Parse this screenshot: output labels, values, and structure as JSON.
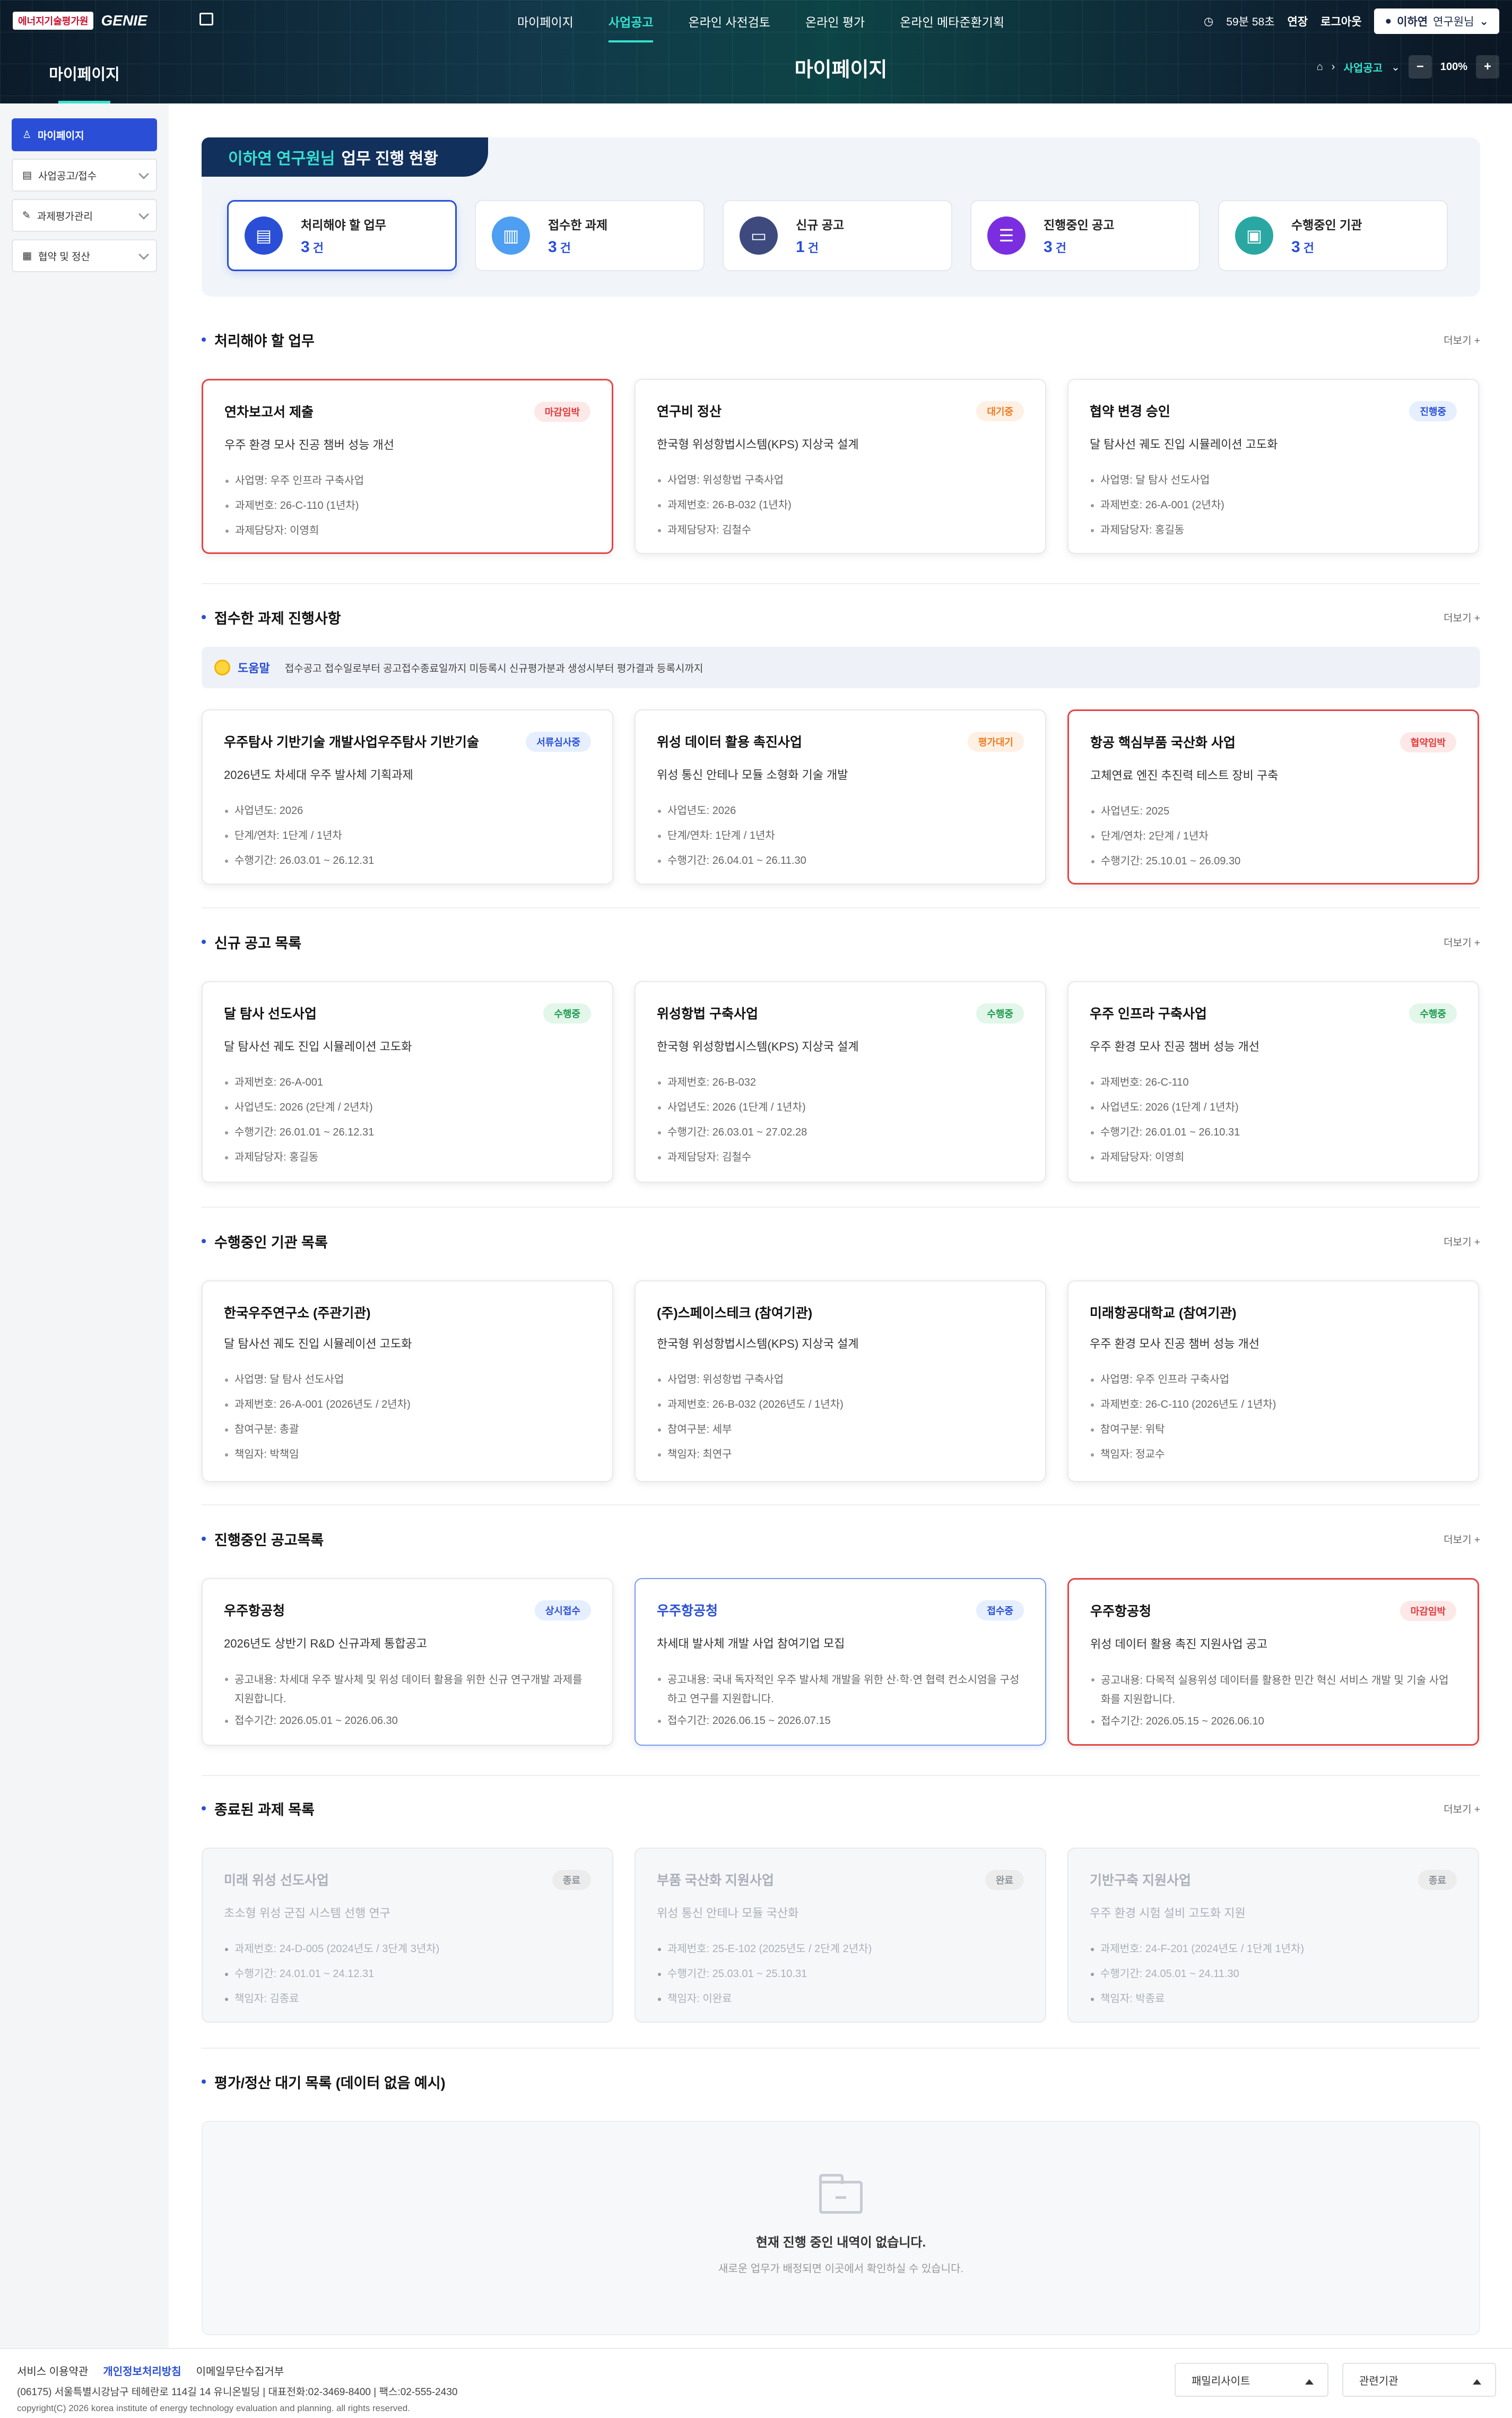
{
  "header": {
    "logo_ketep": "에너지기술평가원",
    "logo_genie": "GENIE",
    "gnb": [
      "마이페이지",
      "사업공고",
      "온라인 사전검토",
      "온라인 평가",
      "온라인 메타준환기획"
    ],
    "timer": "59분 58초",
    "extend": "연장",
    "logout": "로그아웃",
    "user": "이하연",
    "user_role": "연구원님"
  },
  "hero": {
    "lnb_title": "마이페이지",
    "page_title": "마이페이지",
    "crumb": "사업공고",
    "zoom": "100%"
  },
  "sidebar": [
    {
      "label": "마이페이지"
    },
    {
      "label": "사업공고/접수"
    },
    {
      "label": "과제평가관리"
    },
    {
      "label": "협약 및 정산"
    }
  ],
  "summary": {
    "name": "이하연 연구원님",
    "title": "업무 진행 현황",
    "unit": "건",
    "cards": [
      {
        "label": "처리해야 할 업무",
        "count": "3",
        "color": "#2a4fd6"
      },
      {
        "label": "접수한 과제",
        "count": "3",
        "color": "#4e9ef1"
      },
      {
        "label": "신규 공고",
        "count": "1",
        "color": "#3e4a7e"
      },
      {
        "label": "진행중인 공고",
        "count": "3",
        "color": "#7b2ee0"
      },
      {
        "label": "수행중인 기관",
        "count": "3",
        "color": "#2aa7a3"
      }
    ]
  },
  "more": "더보기 +",
  "sections": {
    "todo": {
      "title": "처리해야 할 업무",
      "cards": [
        {
          "title": "연차보고서 제출",
          "badge": "마감임박",
          "subtitle": "우주 환경 모사 진공 챔버 성능 개선",
          "items": [
            "사업명: 우주 인프라 구축사업",
            "과제번호: 26-C-110 (1년차)",
            "과제담당자: 이영희"
          ]
        },
        {
          "title": "연구비 정산",
          "badge": "대기중",
          "subtitle": "한국형 위성항법시스템(KPS) 지상국 설계",
          "items": [
            "사업명: 위성항법 구축사업",
            "과제번호: 26-B-032 (1년차)",
            "과제담당자: 김철수"
          ]
        },
        {
          "title": "협약 변경 승인",
          "badge": "진행중",
          "subtitle": "달 탐사선 궤도 진입 시뮬레이션 고도화",
          "items": [
            "사업명: 달 탐사 선도사업",
            "과제번호: 26-A-001 (2년차)",
            "과제담당자: 홍길동"
          ]
        }
      ]
    },
    "received": {
      "title": "접수한 과제 진행사항",
      "help_label": "도움말",
      "help_text": "접수공고 접수일로부터 공고접수종료일까지 미등록시 신규평가분과 생성시부터 평가결과 등록시까지",
      "cards": [
        {
          "title": "우주탐사 기반기술 개발사업우주탐사 기반기술",
          "badge": "서류심사중",
          "subtitle": "2026년도 차세대 우주 발사체 기획과제",
          "items": [
            "사업년도: 2026",
            "단계/연차: 1단계 / 1년차",
            "수행기간: 26.03.01 ~ 26.12.31"
          ]
        },
        {
          "title": "위성 데이터 활용 촉진사업",
          "badge": "평가대기",
          "subtitle": "위성 통신 안테나 모듈 소형화 기술 개발",
          "items": [
            "사업년도: 2026",
            "단계/연차: 1단계 / 1년차",
            "수행기간: 26.04.01 ~ 26.11.30"
          ]
        },
        {
          "title": "항공 핵심부품 국산화 사업",
          "badge": "협약임박",
          "subtitle": "고체연료 엔진 추진력 테스트 장비 구축",
          "items": [
            "사업년도: 2025",
            "단계/연차: 2단계 / 1년차",
            "수행기간: 25.10.01 ~ 26.09.30"
          ]
        }
      ]
    },
    "new": {
      "title": "신규 공고 목록",
      "cards": [
        {
          "title": "달 탐사 선도사업",
          "badge": "수행중",
          "subtitle": "달 탐사선 궤도 진입 시뮬레이션 고도화",
          "items": [
            "과제번호: 26-A-001",
            "사업년도: 2026 (2단계 / 2년차)",
            "수행기간: 26.01.01 ~ 26.12.31",
            "과제담당자: 홍길동"
          ]
        },
        {
          "title": "위성항법 구축사업",
          "badge": "수행중",
          "subtitle": "한국형 위성항법시스템(KPS) 지상국 설계",
          "items": [
            "과제번호: 26-B-032",
            "사업년도: 2026 (1단계 / 1년차)",
            "수행기간: 26.03.01 ~ 27.02.28",
            "과제담당자: 김철수"
          ]
        },
        {
          "title": "우주 인프라 구축사업",
          "badge": "수행중",
          "subtitle": "우주 환경 모사 진공 챔버 성능 개선",
          "items": [
            "과제번호: 26-C-110",
            "사업년도: 2026 (1단계 / 1년차)",
            "수행기간: 26.01.01 ~ 26.10.31",
            "과제담당자: 이영희"
          ]
        }
      ]
    },
    "orgs": {
      "title": "수행중인 기관 목록",
      "cards": [
        {
          "title": "한국우주연구소 (주관기관)",
          "subtitle": "달 탐사선 궤도 진입 시뮬레이션 고도화",
          "items": [
            "사업명: 달 탐사 선도사업",
            "과제번호: 26-A-001 (2026년도 / 2년차)",
            "참여구분: 총괄",
            "책임자: 박책임"
          ]
        },
        {
          "title": "(주)스페이스테크 (참여기관)",
          "subtitle": "한국형 위성항법시스템(KPS) 지상국 설계",
          "items": [
            "사업명: 위성항법 구축사업",
            "과제번호: 26-B-032 (2026년도 / 1년차)",
            "참여구분: 세부",
            "책임자: 최연구"
          ]
        },
        {
          "title": "미래항공대학교 (참여기관)",
          "subtitle": "우주 환경 모사 진공 챔버 성능 개선",
          "items": [
            "사업명: 우주 인프라 구축사업",
            "과제번호: 26-C-110 (2026년도 / 1년차)",
            "참여구분: 위탁",
            "책임자: 정교수"
          ]
        }
      ]
    },
    "ongoing": {
      "title": "진행중인 공고목록",
      "cards": [
        {
          "title": "우주항공청",
          "badge": "상시접수",
          "subtitle": "2026년도 상반기 R&D 신규과제 통합공고",
          "items": [
            "공고내용: 차세대 우주 발사체 및 위성 데이터 활용을 위한 신규 연구개발 과제를 지원합니다.",
            "접수기간: 2026.05.01 ~ 2026.06.30"
          ]
        },
        {
          "title": "우주항공청",
          "badge": "접수중",
          "subtitle": "차세대 발사체 개발 사업 참여기업 모집",
          "items": [
            "공고내용: 국내 독자적인 우주 발사체 개발을 위한 산·학·연 협력 컨소시엄을 구성하고 연구를 지원합니다.",
            "접수기간: 2026.06.15 ~ 2026.07.15"
          ]
        },
        {
          "title": "우주항공청",
          "badge": "마감임박",
          "subtitle": "위성 데이터 활용 촉진 지원사업 공고",
          "items": [
            "공고내용: 다목적 실용위성 데이터를 활용한 민간 혁신 서비스 개발 및 기술 사업화를 지원합니다.",
            "접수기간: 2026.05.15 ~ 2026.06.10"
          ]
        }
      ]
    },
    "finished": {
      "title": "종료된 과제 목록",
      "cards": [
        {
          "title": "미래 위성 선도사업",
          "badge": "종료",
          "subtitle": "초소형 위성 군집 시스템 선행 연구",
          "items": [
            "과제번호: 24-D-005 (2024년도 / 3단계 3년차)",
            "수행기간: 24.01.01 ~ 24.12.31",
            "책임자: 김종료"
          ]
        },
        {
          "title": "부품 국산화 지원사업",
          "badge": "완료",
          "subtitle": "위성 통신 안테나 모듈 국산화",
          "items": [
            "과제번호: 25-E-102 (2025년도 / 2단계 2년차)",
            "수행기간: 25.03.01 ~ 25.10.31",
            "책임자: 이완료"
          ]
        },
        {
          "title": "기반구축 지원사업",
          "badge": "종료",
          "subtitle": "우주 환경 시험 설비 고도화 지원",
          "items": [
            "과제번호: 24-F-201 (2024년도 / 1단계 1년차)",
            "수행기간: 24.05.01 ~ 24.11.30",
            "책임자: 박종료"
          ]
        }
      ]
    },
    "pending": {
      "title": "평가/정산 대기 목록 (데이터 없음 예시)",
      "empty_title": "현재 진행 중인 내역이 없습니다.",
      "empty_desc": "새로운 업무가 배정되면 이곳에서 확인하실 수 있습니다."
    }
  },
  "footer": {
    "links": [
      "서비스 이용약관",
      "개인정보처리방침",
      "이메일무단수집거부"
    ],
    "address": "(06175) 서울특별시강남구 테헤란로 114길 14 유니온빌딩 | 대표전화:02-3469-8400 | 팩스:02-555-2430",
    "copyright": "copyright(C) 2026 korea institute of energy technology evaluation and planning. all rights reserved.",
    "family": "패밀리사이트",
    "related": "관련기관"
  }
}
